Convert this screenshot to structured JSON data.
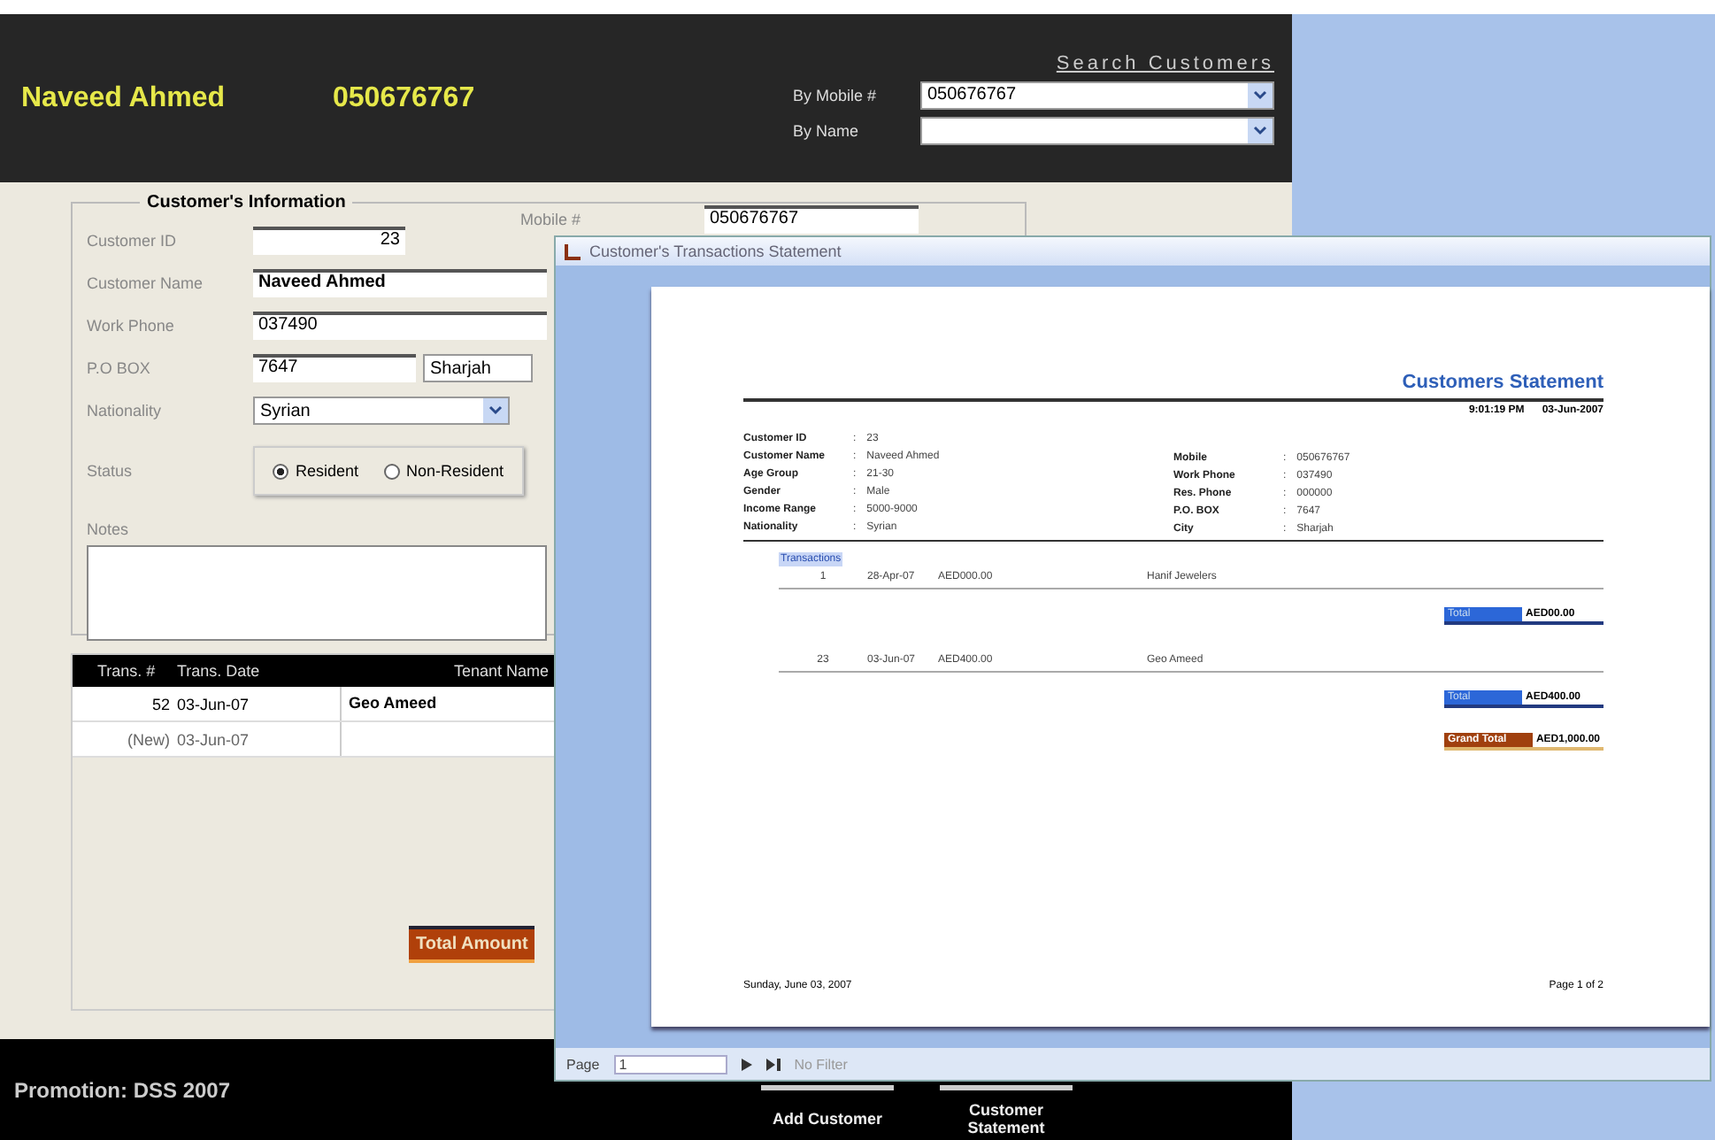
{
  "header": {
    "customer_name": "Naveed Ahmed",
    "mobile": "050676767",
    "search": {
      "title": "Search Customers",
      "fields": [
        {
          "label": "By Mobile #",
          "value": "050676767"
        },
        {
          "label": "By Name"
        }
      ]
    }
  },
  "info": {
    "title": "Customer's Information",
    "fields": [
      {
        "kind": "number",
        "label": "Customer ID",
        "value": "23"
      },
      {
        "kind": "text",
        "label": "Customer Name",
        "value": "Naveed Ahmed",
        "bold": true
      },
      {
        "kind": "text",
        "label": "Work Phone",
        "value": "037490",
        "bold": false
      },
      {
        "kind": "text_combo",
        "label": "P.O BOX",
        "value": "7647",
        "combo": "Sharjah"
      },
      {
        "kind": "combo",
        "label": "Nationality",
        "value": "Syrian"
      }
    ],
    "mobile_field": {
      "label": "Mobile #",
      "value": "050676767"
    },
    "status": {
      "label": "Status",
      "options": [
        {
          "label": "Resident",
          "selected": true
        },
        {
          "label": "Non-Resident",
          "selected": false
        }
      ]
    },
    "notes": {
      "label": "Notes"
    }
  },
  "transactions": {
    "columns": [
      "Trans. #",
      "Trans. Date",
      "Tenant Name"
    ],
    "rows": [
      {
        "cells": [
          "52",
          "03-Jun-07",
          "Geo Ameed"
        ],
        "new": false
      },
      {
        "cells": [
          "(New)",
          "03-Jun-07",
          ""
        ],
        "new": true
      }
    ]
  },
  "total_button": "Total Amount",
  "footer": {
    "promotion": "Promotion: DSS 2007",
    "buttons": [
      "Add Customer",
      "Customer Statement"
    ]
  },
  "statement_window": {
    "title": "Customer's Transactions Statement",
    "report": {
      "title": "Customers Statement",
      "time": "9:01:19 PM",
      "date": "03-Jun-2007",
      "left_fields": [
        {
          "label": "Customer ID",
          "sep": ":",
          "value": "23"
        },
        {
          "label": "Customer Name",
          "sep": ":",
          "value": "Naveed Ahmed"
        },
        {
          "label": "Age Group",
          "sep": ":",
          "value": "21-30"
        },
        {
          "label": "Gender",
          "sep": ":",
          "value": "Male"
        },
        {
          "label": "Income Range",
          "sep": ":",
          "value": "5000-9000"
        },
        {
          "label": "Nationality",
          "sep": ":",
          "value": "Syrian"
        }
      ],
      "right_fields": [
        {
          "label": "Mobile",
          "sep": ":",
          "value": "050676767"
        },
        {
          "label": "Work Phone",
          "sep": ":",
          "value": "037490"
        },
        {
          "label": "Res. Phone",
          "sep": ":",
          "value": "000000"
        },
        {
          "label": "P.O. BOX",
          "sep": ":",
          "value": "7647"
        },
        {
          "label": "City",
          "sep": ":",
          "value": "Sharjah"
        }
      ],
      "section": "Transactions",
      "groups": [
        {
          "row": [
            "1",
            "28-Apr-07",
            "AED000.00",
            "Hanif Jewelers"
          ],
          "total_label": "Total",
          "total": "AED00.00"
        },
        {
          "row": [
            "23",
            "03-Jun-07",
            "AED400.00",
            "Geo Ameed"
          ],
          "total_label": "Total",
          "total": "AED400.00"
        }
      ],
      "grand_total_label": "Grand Total",
      "grand_total": "AED1,000.00",
      "footer_date": "Sunday, June 03, 2007",
      "footer_page": "Page 1 of 2"
    },
    "nav": {
      "page_label": "Page",
      "page": "1",
      "filter": "No Filter"
    }
  }
}
